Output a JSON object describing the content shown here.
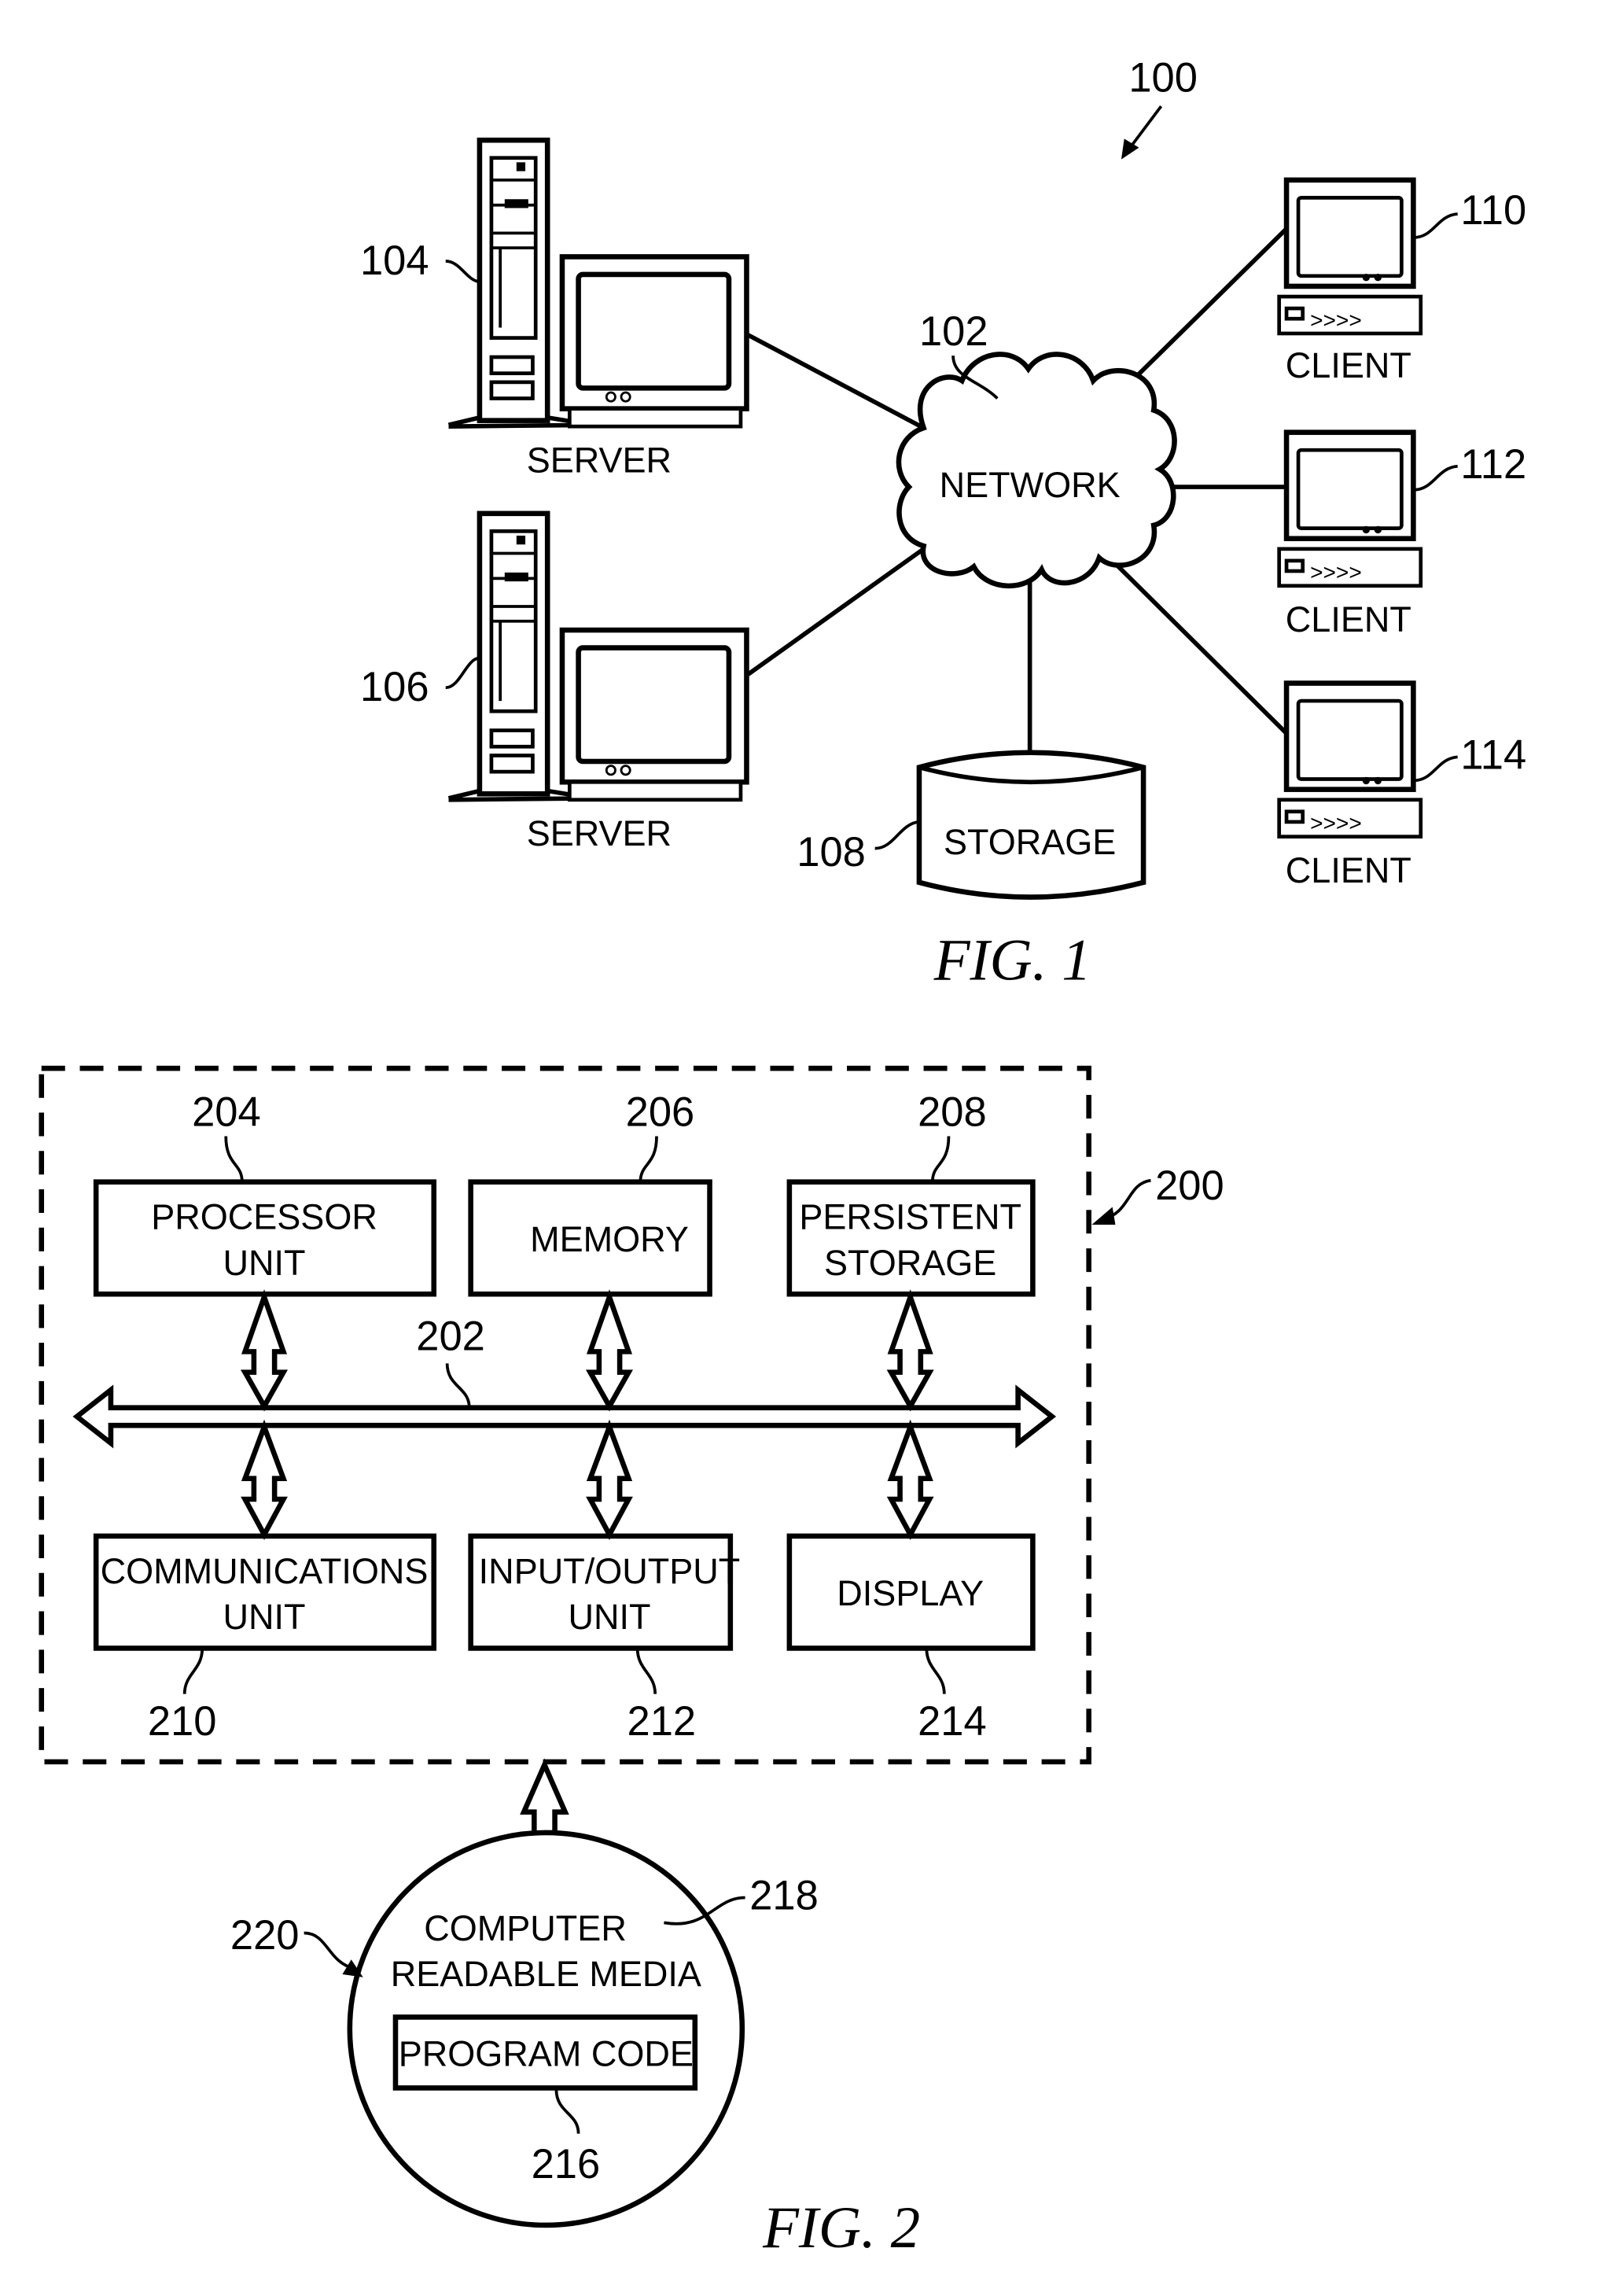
{
  "fig1": {
    "caption": "FIG. 1",
    "system_ref": "100",
    "network": {
      "ref": "102",
      "label": "NETWORK"
    },
    "servers": [
      {
        "ref": "104",
        "label": "SERVER"
      },
      {
        "ref": "106",
        "label": "SERVER"
      }
    ],
    "storage": {
      "ref": "108",
      "label": "STORAGE"
    },
    "clients": [
      {
        "ref": "110",
        "label": "CLIENT"
      },
      {
        "ref": "112",
        "label": "CLIENT"
      },
      {
        "ref": "114",
        "label": "CLIENT"
      }
    ]
  },
  "fig2": {
    "caption": "FIG. 2",
    "system_ref": "200",
    "bus_ref": "202",
    "top_units": [
      {
        "ref": "204",
        "line1": "PROCESSOR",
        "line2": "UNIT"
      },
      {
        "ref": "206",
        "line1": "MEMORY",
        "line2": ""
      },
      {
        "ref": "208",
        "line1": "PERSISTENT",
        "line2": "STORAGE"
      }
    ],
    "bottom_units": [
      {
        "ref": "210",
        "line1": "COMMUNICATIONS",
        "line2": "UNIT"
      },
      {
        "ref": "212",
        "line1": "INPUT/OUTPUT",
        "line2": "UNIT"
      },
      {
        "ref": "214",
        "line1": "DISPLAY",
        "line2": ""
      }
    ],
    "media": {
      "ref": "220",
      "media_ref": "218",
      "line1": "COMPUTER",
      "line2": "READABLE MEDIA",
      "program_code": {
        "ref": "216",
        "label": "PROGRAM CODE"
      }
    }
  }
}
